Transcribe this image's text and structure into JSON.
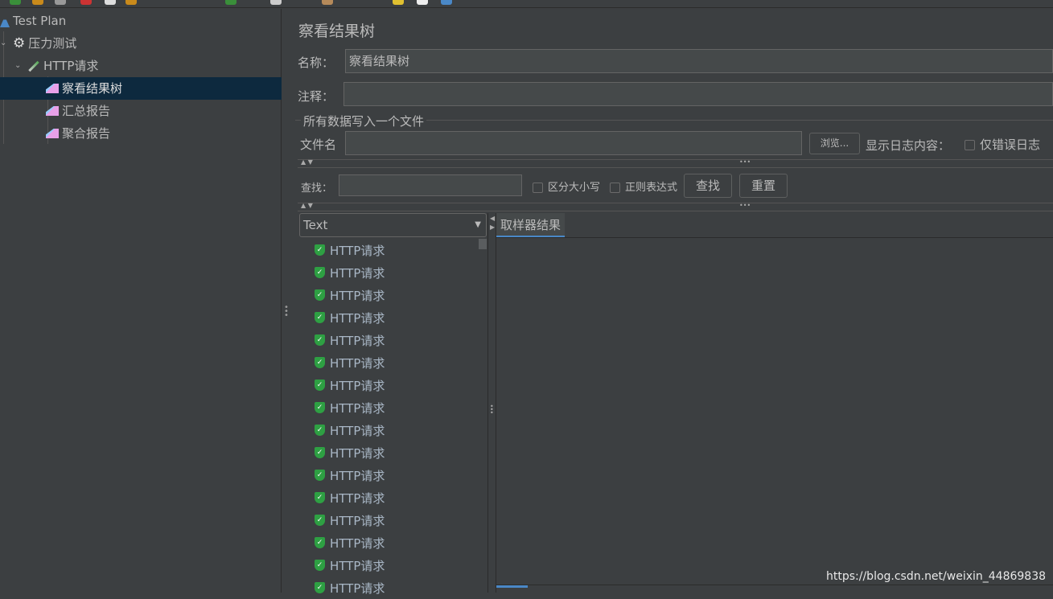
{
  "tree": {
    "items": [
      {
        "label": "Test Plan",
        "icon": "test-plan-flask-icon"
      },
      {
        "label": "压力测试",
        "icon": "thread-group-gear-icon"
      },
      {
        "label": "HTTP请求",
        "icon": "sampler-pipette-icon"
      },
      {
        "label": "察看结果树",
        "icon": "listener-chart-icon",
        "selected": true
      },
      {
        "label": "汇总报告",
        "icon": "listener-chart-icon"
      },
      {
        "label": "聚合报告",
        "icon": "listener-chart-icon"
      }
    ]
  },
  "panel": {
    "title": "察看结果树",
    "name_label": "名称：",
    "name_value": "察看结果树",
    "comment_label": "注释：",
    "comment_value": "",
    "file_group": "所有数据写入一个文件",
    "filename_label": "文件名",
    "filename_value": "",
    "browse": "浏览...",
    "log_label": "显示日志内容：",
    "errors_only": "仅错误日志",
    "search_label": "查找：",
    "search_value": "",
    "case_sensitive": "区分大小写",
    "regex": "正则表达式",
    "find_btn": "查找",
    "reset_btn": "重置",
    "renderer": "Text",
    "tab": "取样器结果",
    "results": [
      "HTTP请求",
      "HTTP请求",
      "HTTP请求",
      "HTTP请求",
      "HTTP请求",
      "HTTP请求",
      "HTTP请求",
      "HTTP请求",
      "HTTP请求",
      "HTTP请求",
      "HTTP请求",
      "HTTP请求",
      "HTTP请求",
      "HTTP请求",
      "HTTP请求",
      "HTTP请求"
    ],
    "result_status": "success"
  },
  "watermark": "https://blog.csdn.net/weixin_44869838",
  "colors": {
    "bg": "#3c3f41",
    "selected": "#0d293e",
    "input": "#45494a",
    "success": "#2ea043",
    "tab_accent": "#4a88c7"
  }
}
